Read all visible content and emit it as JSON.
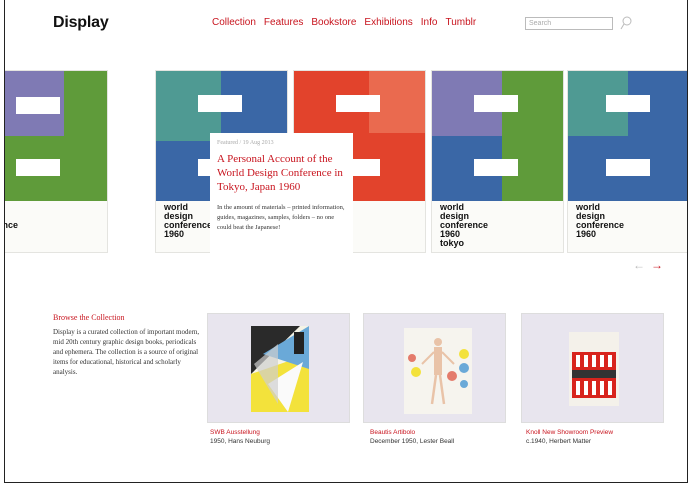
{
  "header": {
    "logo": "Display",
    "nav": [
      "Collection",
      "Features",
      "Bookstore",
      "Exhibitions",
      "Info",
      "Tumblr"
    ],
    "search_placeholder": "Search"
  },
  "poster": {
    "line1": "world",
    "line2": "design",
    "line3": "conference",
    "line4": "1960",
    "line5": "tokyo",
    "colors": {
      "green": "#5f9b3a",
      "blue": "#3a67a6",
      "lavender": "#7f7ab4",
      "teal": "#4f9a93",
      "red": "#e2432c"
    }
  },
  "feature": {
    "meta": "Featured / 19 Aug 2013",
    "title": "A Personal Account of the World Design Conference in Tokyo, Japan 1960",
    "body": "In the amount of materials – printed information, guides, magazines, samples, folders – no one could beat the Japanese!"
  },
  "carousel": {
    "prev": "←",
    "next": "→"
  },
  "browse": {
    "title": "Browse the Collection",
    "text": "Display is a curated collection of important modern, mid 20th century graphic design books, periodicals and ephemera. The collection is a source of original items for educational, historical and scholarly analysis."
  },
  "tiles": [
    {
      "title": "SWB Ausstellung",
      "subtitle": "1950, Hans Neuburg"
    },
    {
      "title": "Beautis Artibolo",
      "subtitle": "December 1950, Lester Beall"
    },
    {
      "title": "Knoll New Showroom Preview",
      "subtitle": "c.1940, Herbert Matter"
    }
  ],
  "colors": {
    "accent": "#c8141e"
  }
}
